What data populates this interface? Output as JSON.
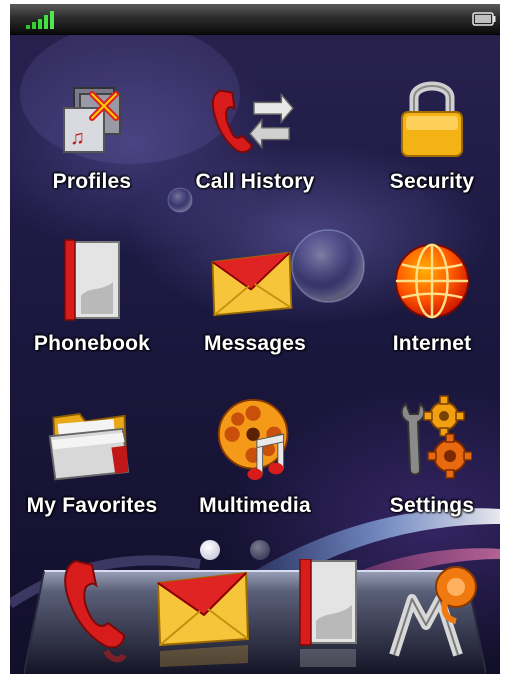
{
  "status_bar": {
    "signal_icon": "signal-strength-icon",
    "battery_icon": "battery-icon"
  },
  "grid": {
    "items": [
      {
        "label": "Profiles",
        "icon": "profiles-icon"
      },
      {
        "label": "Call History",
        "icon": "call-history-icon"
      },
      {
        "label": "Security",
        "icon": "padlock-icon"
      },
      {
        "label": "Phonebook",
        "icon": "phonebook-icon"
      },
      {
        "label": "Messages",
        "icon": "envelope-icon"
      },
      {
        "label": "Internet",
        "icon": "globe-icon"
      },
      {
        "label": "My Favorites",
        "icon": "folder-icon"
      },
      {
        "label": "Multimedia",
        "icon": "film-reel-music-icon"
      },
      {
        "label": "Settings",
        "icon": "tools-gears-icon"
      }
    ]
  },
  "pager": {
    "page_count": 2,
    "active_page": 1
  },
  "dock": {
    "items": [
      {
        "icon": "phone-handset-icon"
      },
      {
        "icon": "envelope-icon"
      },
      {
        "icon": "phonebook-icon"
      },
      {
        "icon": "motorola-logo-icon"
      }
    ]
  },
  "colors": {
    "label_text": "#ffffff",
    "background": "#1d1a44",
    "signal": "#33dd33"
  }
}
